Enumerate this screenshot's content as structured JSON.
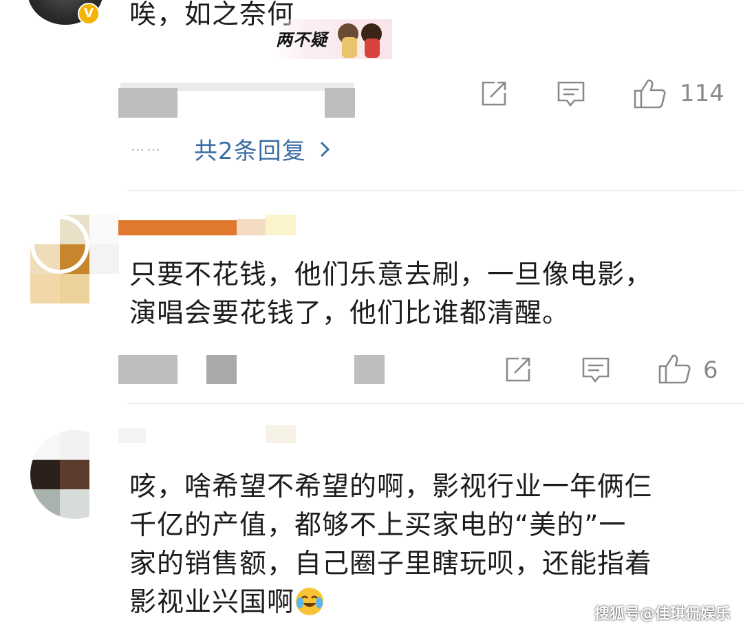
{
  "comments": [
    {
      "text": "唉，如之奈何",
      "sticker_label": "两不疑",
      "like_count": "114",
      "replies_label": "共2条回复",
      "replies_dots": "……"
    },
    {
      "text_line1": "只要不花钱，他们乐意去刷，一旦像电影，",
      "text_line2": "演唱会要花钱了，他们比谁都清醒。",
      "like_count": "6"
    },
    {
      "text_line1": "咳，啥希望不希望的啊，影视行业一年俩仨",
      "text_line2": "千亿的产值，都够不上买家电的“美的”一",
      "text_line3": "家的销售额，自己圈子里瞎玩呗，还能指着",
      "text_line4": "影视业兴国啊"
    }
  ],
  "watermark": "搜狐号@佳琪侃娱乐",
  "badge_letter": "V",
  "colors": {
    "link": "#3b6ea5",
    "icon": "#8a8a8a",
    "badge": "#f5b400"
  },
  "icons": [
    "share-icon",
    "comment-icon",
    "like-icon",
    "chevron-right-icon",
    "crying-laughing-emoji"
  ]
}
